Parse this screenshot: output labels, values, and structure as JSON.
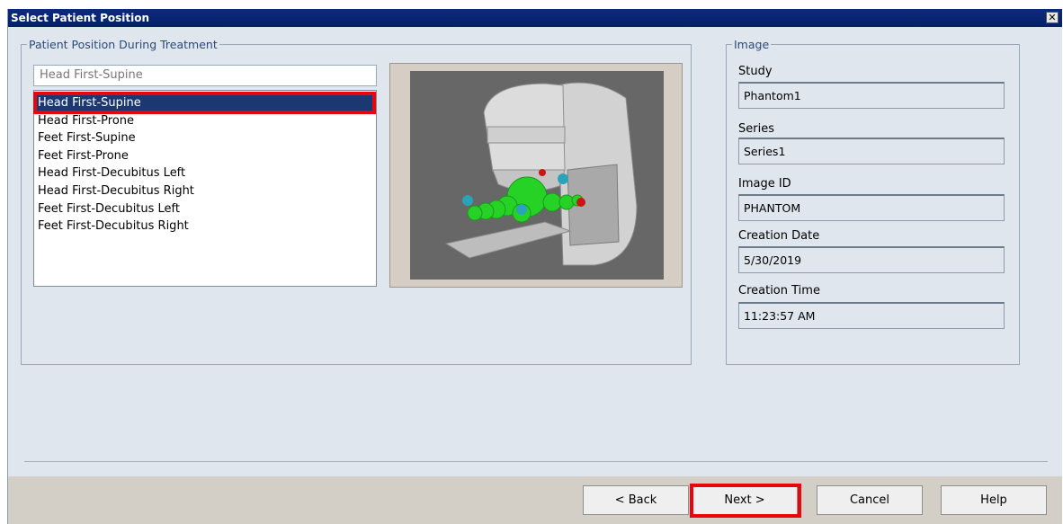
{
  "window": {
    "title": "Select Patient Position",
    "close_glyph": "✕"
  },
  "position_group": {
    "legend": "Patient Position During Treatment",
    "combo_value": "Head First-Supine",
    "options": [
      {
        "label": "Head First-Supine",
        "selected": true
      },
      {
        "label": "Head First-Prone",
        "selected": false
      },
      {
        "label": "Feet First-Supine",
        "selected": false
      },
      {
        "label": "Feet First-Prone",
        "selected": false
      },
      {
        "label": "Head First-Decubitus Left",
        "selected": false
      },
      {
        "label": "Head First-Decubitus Right",
        "selected": false
      },
      {
        "label": "Feet First-Decubitus Left",
        "selected": false
      },
      {
        "label": "Feet First-Decubitus Right",
        "selected": false
      }
    ],
    "preview_icon": "linac-patient-icon"
  },
  "image_group": {
    "legend": "Image",
    "study_label": "Study",
    "study_value": "Phantom1",
    "series_label": "Series",
    "series_value": "Series1",
    "image_id_label": "Image ID",
    "image_id_value": "PHANTOM",
    "creation_date_label": "Creation Date",
    "creation_date_value": "5/30/2019",
    "creation_time_label": "Creation Time",
    "creation_time_value": "11:23:57 AM"
  },
  "buttons": {
    "back": "< Back",
    "next": "Next >",
    "cancel": "Cancel",
    "help": "Help"
  },
  "colors": {
    "title_bar": "#05206a",
    "selection": "#1b3872",
    "highlight": "#e8060d",
    "dialog_bg": "#dfe6ee"
  }
}
